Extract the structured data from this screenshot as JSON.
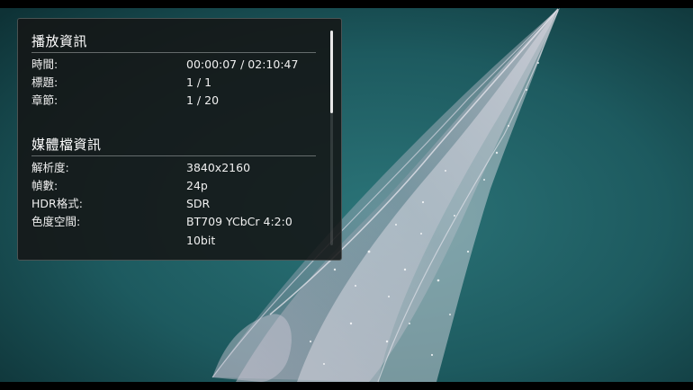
{
  "playback": {
    "title": "播放資訊",
    "rows": [
      {
        "label": "時間:",
        "value": "00:00:07 / 02:10:47"
      },
      {
        "label": "標題:",
        "value": "1 / 1"
      },
      {
        "label": "章節:",
        "value": "1 / 20"
      }
    ]
  },
  "media": {
    "title": "媒體檔資訊",
    "rows": [
      {
        "label": "解析度:",
        "value": "3840x2160"
      },
      {
        "label": "幀數:",
        "value": "24p"
      },
      {
        "label": "HDR格式:",
        "value": "SDR"
      },
      {
        "label": "色度空間:",
        "value": "BT709 YCbCr 4:2:0"
      },
      {
        "label": "",
        "value": "10bit"
      }
    ]
  },
  "colors": {
    "panel_bg": "#141616",
    "video_bg": "#1f5a5e",
    "text": "#f0f0f0"
  },
  "scroll": {
    "thumb_fraction": 0.38,
    "position_fraction": 0.0
  }
}
